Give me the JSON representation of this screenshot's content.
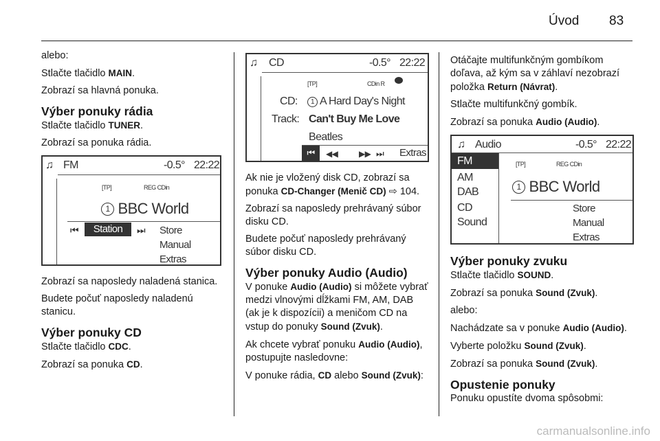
{
  "header": {
    "title": "Úvod",
    "page_number": "83"
  },
  "columns": [
    [
      {
        "type": "p",
        "parts": [
          {
            "t": "alebo:"
          }
        ]
      },
      {
        "type": "p",
        "parts": [
          {
            "t": "Stlačte tlačidlo "
          },
          {
            "t": "MAIN",
            "b": true
          },
          {
            "t": "."
          }
        ]
      },
      {
        "type": "p",
        "parts": [
          {
            "t": "Zobrazí sa hlavná ponuka."
          }
        ]
      },
      {
        "type": "h",
        "parts": [
          {
            "t": "Výber ponuky rádia"
          }
        ]
      },
      {
        "type": "p",
        "parts": [
          {
            "t": "Stlačte tlačidlo "
          },
          {
            "t": "TUNER",
            "b": true
          },
          {
            "t": "."
          }
        ]
      },
      {
        "type": "p",
        "parts": [
          {
            "t": "Zobrazí sa ponuka rádia."
          }
        ]
      },
      {
        "type": "screen",
        "id": "fm"
      },
      {
        "type": "p",
        "parts": [
          {
            "t": "Zobrazí sa naposledy naladená stanica."
          }
        ]
      },
      {
        "type": "p",
        "parts": [
          {
            "t": "Budete počuť naposledy naladenú stanicu."
          }
        ]
      },
      {
        "type": "h",
        "parts": [
          {
            "t": "Výber ponuky CD"
          }
        ]
      },
      {
        "type": "p",
        "parts": [
          {
            "t": "Stlačte tlačidlo "
          },
          {
            "t": "CDC",
            "b": true
          },
          {
            "t": "."
          }
        ]
      },
      {
        "type": "p",
        "parts": [
          {
            "t": "Zobrazí sa ponuka "
          },
          {
            "t": "CD",
            "b": true
          },
          {
            "t": "."
          }
        ]
      }
    ],
    [
      {
        "type": "screen",
        "id": "cd"
      },
      {
        "type": "p",
        "parts": [
          {
            "t": "Ak nie je vložený disk CD, zobrazí sa ponuka "
          },
          {
            "t": "CD-Changer (Menič CD)",
            "b": true
          },
          {
            "t": " ⇨ 104."
          }
        ]
      },
      {
        "type": "p",
        "parts": [
          {
            "t": "Zobrazí sa naposledy prehrávaný súbor disku CD."
          }
        ]
      },
      {
        "type": "p",
        "parts": [
          {
            "t": "Budete počuť naposledy prehrávaný súbor disku CD."
          }
        ]
      },
      {
        "type": "h",
        "parts": [
          {
            "t": "Výber ponuky Audio (Audio)"
          }
        ]
      },
      {
        "type": "p",
        "parts": [
          {
            "t": "V ponuke "
          },
          {
            "t": "Audio (Audio)",
            "b": true
          },
          {
            "t": " si môžete vybrať medzi vlnovými dĺžkami FM, AM, DAB (ak je k dispozícii) a meničom CD na vstup do ponuky "
          },
          {
            "t": "Sound (Zvuk)",
            "b": true
          },
          {
            "t": "."
          }
        ]
      },
      {
        "type": "p",
        "parts": [
          {
            "t": "Ak chcete vybrať ponuku "
          },
          {
            "t": "Audio (Audio)",
            "b": true
          },
          {
            "t": ", postupujte nasledovne:"
          }
        ]
      },
      {
        "type": "p",
        "parts": [
          {
            "t": "V ponuke rádia, "
          },
          {
            "t": "CD",
            "b": true
          },
          {
            "t": " alebo "
          },
          {
            "t": "Sound (Zvuk)",
            "b": true
          },
          {
            "t": ":"
          }
        ]
      }
    ],
    [
      {
        "type": "p",
        "parts": [
          {
            "t": "Otáčajte multifunkčným gombíkom doľava, až kým sa v záhlaví nezobrazí položka "
          },
          {
            "t": "Return (Návrat)",
            "b": true
          },
          {
            "t": "."
          }
        ]
      },
      {
        "type": "p",
        "parts": [
          {
            "t": "Stlačte multifunkčný gombík."
          }
        ]
      },
      {
        "type": "p",
        "parts": [
          {
            "t": "Zobrazí sa ponuka "
          },
          {
            "t": "Audio (Audio)",
            "b": true
          },
          {
            "t": "."
          }
        ]
      },
      {
        "type": "screen",
        "id": "audio"
      },
      {
        "type": "h",
        "parts": [
          {
            "t": "Výber ponuky zvuku"
          }
        ]
      },
      {
        "type": "p",
        "parts": [
          {
            "t": "Stlačte tlačidlo "
          },
          {
            "t": "SOUND",
            "b": true
          },
          {
            "t": "."
          }
        ]
      },
      {
        "type": "p",
        "parts": [
          {
            "t": "Zobrazí sa ponuka "
          },
          {
            "t": "Sound (Zvuk)",
            "b": true
          },
          {
            "t": "."
          }
        ]
      },
      {
        "type": "p",
        "parts": [
          {
            "t": "alebo:"
          }
        ]
      },
      {
        "type": "p",
        "parts": [
          {
            "t": "Nachádzate sa v ponuke "
          },
          {
            "t": "Audio (Audio)",
            "b": true
          },
          {
            "t": "."
          }
        ]
      },
      {
        "type": "p",
        "parts": [
          {
            "t": "Vyberte položku "
          },
          {
            "t": "Sound (Zvuk)",
            "b": true
          },
          {
            "t": "."
          }
        ]
      },
      {
        "type": "p",
        "parts": [
          {
            "t": "Zobrazí sa ponuka "
          },
          {
            "t": "Sound (Zvuk)",
            "b": true
          },
          {
            "t": "."
          }
        ]
      },
      {
        "type": "h",
        "parts": [
          {
            "t": "Opustenie ponuky"
          }
        ]
      },
      {
        "type": "p",
        "parts": [
          {
            "t": "Ponuku opustíte dvoma spôsobmi:"
          }
        ]
      }
    ]
  ],
  "screens": {
    "fm": {
      "icon": "music-note-icon",
      "title": "FM",
      "temp": "-0.5°",
      "time": "22:22",
      "tp": "[TP]",
      "status": "REG  CDin",
      "station": "BBC World",
      "preset": "1",
      "selected": "Station",
      "menu": [
        "Store",
        "Manual",
        "Extras"
      ]
    },
    "cd": {
      "icon": "music-note-icon",
      "title": "CD",
      "temp": "-0.5°",
      "time": "22:22",
      "tp": "[TP]",
      "status": "CDin  R",
      "cd_label": "CD:",
      "album": "A Hard Day's Night",
      "preset": "1",
      "track_label": "Track:",
      "track": "Can't Buy Me Love",
      "artist": "Beatles",
      "extras": "Extras"
    },
    "audio": {
      "icon": "music-note-icon",
      "title": "Audio",
      "temp": "-0.5°",
      "time": "22:22",
      "tp": "[TP]",
      "status": "REG  CDin",
      "sources": [
        "FM",
        "AM",
        "DAB",
        "CD",
        "Sound"
      ],
      "selected_source": "FM",
      "station": "BBC World",
      "preset": "1",
      "menu": [
        "Store",
        "Manual",
        "Extras"
      ]
    }
  },
  "watermark": "carmanualsonline.info"
}
